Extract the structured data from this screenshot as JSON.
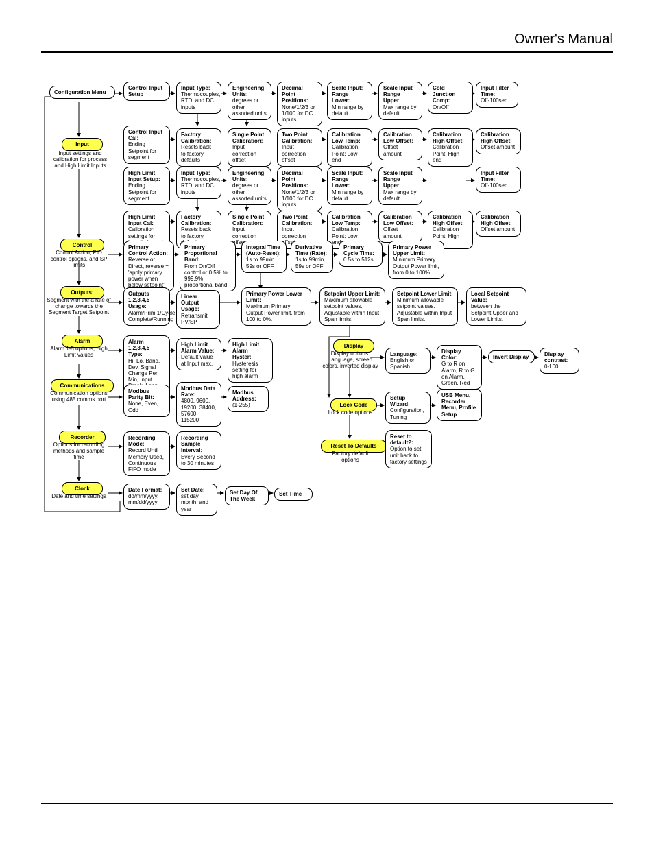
{
  "header": {
    "title": "Owner's Manual"
  },
  "root": {
    "title": "Configuration Menu"
  },
  "left": {
    "input": {
      "title": "Input",
      "desc": "Input settings and calibration for process and High Limit Inputs"
    },
    "control": {
      "title": "Control",
      "desc": "Control Action, PID control options, and SP limits"
    },
    "outputs": {
      "title": "Outputs:",
      "desc": "Segment with the a rate of change towards the Segment Target Setpoint"
    },
    "alarm": {
      "title": "Alarm",
      "desc": "Alarm 1-5 options, High Limit values"
    },
    "comms": {
      "title": "Communications",
      "desc": "Communication options using 485 comms port"
    },
    "recorder": {
      "title": "Recorder",
      "desc": "Options for recording methods and sample time"
    },
    "clock": {
      "title": "Clock",
      "desc": "Date and time settings"
    }
  },
  "r1": [
    {
      "title": "Control Input Setup",
      "desc": ""
    },
    {
      "title": "Input Type:",
      "desc": "Thermocouples, RTD, and DC inputs"
    },
    {
      "title": "Engineering Units:",
      "desc": "degrees or other assorted units"
    },
    {
      "title": "Decimal Point Positions:",
      "desc": "None/1/2/3 or 1/100 for DC inputs"
    },
    {
      "title": "Scale Input: Range Lower:",
      "desc": "Min range by default"
    },
    {
      "title": "Scale Input Range Upper:",
      "desc": "Max range by default"
    },
    {
      "title": "Cold Junction Comp:",
      "desc": "On/Off"
    },
    {
      "title": "Input Filter Time:",
      "desc": "Off-100sec"
    }
  ],
  "r2": [
    {
      "title": "Control Input Cal:",
      "desc": "Ending Setpoint for segment"
    },
    {
      "title": "Factory Calibration:",
      "desc": "Resets back to factory defaults"
    },
    {
      "title": "Single Point Calibration:",
      "desc": "Input correction offset"
    },
    {
      "title": "Two Point Calibration:",
      "desc": "Input correction offset"
    },
    {
      "title": "Calibration Low Temp:",
      "desc": "Calibration Point: Low end"
    },
    {
      "title": "Calibration Low Offset:",
      "desc": "Offset amount"
    },
    {
      "title": "Calibration High Offset:",
      "desc": "Calibration Point: High end"
    },
    {
      "title": "Calibration High Offset:",
      "desc": "Offset amount"
    }
  ],
  "r3": [
    {
      "title": "High Limit Input Setup:",
      "desc": "Ending Setpoint for segment"
    },
    {
      "title": "Input Type:",
      "desc": "Thermocouples, RTD, and DC inputs"
    },
    {
      "title": "Engineering Units:",
      "desc": "degrees or other assorted units"
    },
    {
      "title": "Decimal Point Positions:",
      "desc": "None/1/2/3 or 1/100 for DC inputs"
    },
    {
      "title": "Scale Input: Range Lower:",
      "desc": "Min range by default"
    },
    {
      "title": "Scale Input Range Upper:",
      "desc": "Max range by default"
    },
    {
      "title": "Input Filter Time:",
      "desc": "Off-100sec"
    }
  ],
  "r4": [
    {
      "title": "High Limit Input Cal:",
      "desc": "Calibration settings for high limit input"
    },
    {
      "title": "Factory Calibration:",
      "desc": "Resets back to factory defaults"
    },
    {
      "title": "Single Point Calibration:",
      "desc": "Input correction offset"
    },
    {
      "title": "Two Point Calibration:",
      "desc": "Input correction offset"
    },
    {
      "title": "Calibration Low Temp:",
      "desc": "Calibration Point: Low end"
    },
    {
      "title": "Calibration Low Offset:",
      "desc": "Offset amount"
    },
    {
      "title": "Calibration High Offset:",
      "desc": "Calibration Point: High end"
    },
    {
      "title": "Calibration High Offset:",
      "desc": "Offset amount"
    }
  ],
  "r5": [
    {
      "title": "Primary Control Action:",
      "desc": "Reverse or Direct, reverse = 'apply primary power when below setpoint'"
    },
    {
      "title": "Primary Proportional Band:",
      "desc": "From On/Off control or 0.5% to 999.9% proportional band."
    },
    {
      "title": "Integral Time (Auto-Reset):",
      "desc": "1s to 99min 59s or OFF"
    },
    {
      "title": "Derivative Time (Rate):",
      "desc": "1s to 99min 59s or OFF"
    },
    {
      "title": "Primary Cycle Time:",
      "desc": "0.5s to 512s"
    },
    {
      "title": "Primary Power Upper Limit:",
      "desc": "Minimum Primary Output Power limit, from 0 to 100%"
    }
  ],
  "r6": [
    {
      "title": "Outputs 1,2,3,4,5 Usage:",
      "desc": "Alarm/Prim.1/Cycle Complete/Running"
    },
    {
      "title": "Linear Output Usage:",
      "desc": "Retransmit PV/SP"
    },
    {
      "title": "Primary Power Lower Limit:",
      "desc": "Maximum Primary Output Power limit, from 100 to 0%."
    },
    {
      "title": "Setpoint Upper Limit:",
      "desc": "Maximum allowable setpoint values. Adjustable within Input Span limits."
    },
    {
      "title": "Setpoint Lower Limit:",
      "desc": "Minimum allowable setpoint values. Adjustable within Input Span limits."
    },
    {
      "title": "Local Setpoint Value:",
      "desc": "between the Setpoint Upper and Lower Limits."
    }
  ],
  "r7": [
    {
      "title": "Alarm 1,2,3,4,5 Type:",
      "desc": "Hi, Lo, Band, Dev, Signal Change Per Min, Input Break, Loop Alarm Used"
    },
    {
      "title": "High Limit Alarm Value:",
      "desc": "Default value at Input max."
    },
    {
      "title": "High Limit Alarm Hyster:",
      "desc": "Hysteresis setting for high alarm"
    },
    {
      "title": "Display",
      "desc": "Display options: Language, screen colors, inverted display",
      "hl": true
    },
    {
      "title": "Language:",
      "desc": "English or Spanish"
    },
    {
      "title": "Display Color:",
      "desc": "G to R on Alarm, R to G on Alarm, Green, Red"
    },
    {
      "title": "Invert Display",
      "desc": ""
    },
    {
      "title": "Display contrast:",
      "desc": "0-100"
    }
  ],
  "r8": [
    {
      "title": "Modbus Parity Bit:",
      "desc": "None, Even, Odd"
    },
    {
      "title": "Modbus Data Rate:",
      "desc": "4800, 9600, 19200, 38400, 57600, 115200"
    },
    {
      "title": "Modbus Address:",
      "desc": "(1-255)"
    },
    {
      "title": "Lock Code",
      "desc": "Lock code options",
      "hl": true
    },
    {
      "title": "Setup Wizard:",
      "desc": "Configuration, Tuning"
    },
    {
      "title": "USB Menu, Recorder Menu, Profile Setup",
      "desc": ""
    }
  ],
  "r9": [
    {
      "title": "Recording Mode:",
      "desc": "Record Until Memory Used, Continuous FIFO mode"
    },
    {
      "title": "Recording Sample Interval:",
      "desc": "Every Second to 30 minutes"
    },
    {
      "title": "Reset To Defaults",
      "desc": "Factory default options",
      "hl": true
    },
    {
      "title": "Reset to default?:",
      "desc": "Option to set unit back to factory settings"
    }
  ],
  "r10": [
    {
      "title": "Date Format:",
      "desc": "dd/mm/yyyy, mm/dd/yyyy"
    },
    {
      "title": "Set Date:",
      "desc": "set day, month, and year"
    },
    {
      "title": "Set Day Of The Week",
      "desc": ""
    },
    {
      "title": "Set Time",
      "desc": ""
    }
  ]
}
